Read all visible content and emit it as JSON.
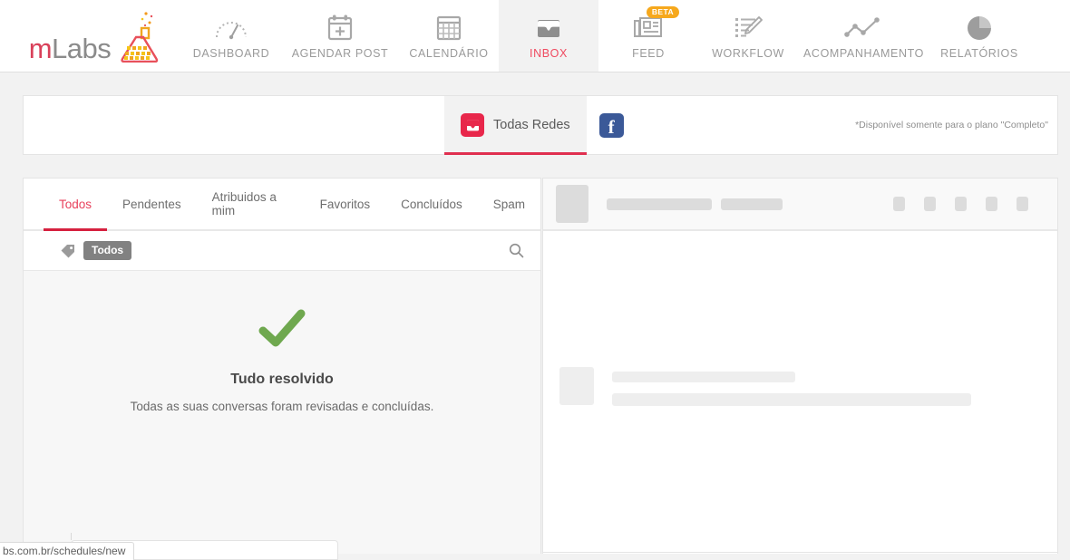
{
  "brand": {
    "name_prefix": "m",
    "name_suffix": "Labs",
    "accent_red": "#d9415a",
    "accent_gray": "#8b8b8b"
  },
  "topnav": {
    "items": [
      {
        "label": "DASHBOARD",
        "icon": "gauge-icon",
        "active": false,
        "badge": null
      },
      {
        "label": "AGENDAR POST",
        "icon": "calendar-plus-icon",
        "active": false,
        "badge": null
      },
      {
        "label": "CALENDÁRIO",
        "icon": "calendar-icon",
        "active": false,
        "badge": null
      },
      {
        "label": "INBOX",
        "icon": "inbox-icon",
        "active": true,
        "badge": null
      },
      {
        "label": "FEED",
        "icon": "newspaper-icon",
        "active": false,
        "badge": "BETA"
      },
      {
        "label": "WORKFLOW",
        "icon": "list-pencil-icon",
        "active": false,
        "badge": null
      },
      {
        "label": "ACOMPANHAMENTO",
        "icon": "line-chart-icon",
        "active": false,
        "badge": null
      },
      {
        "label": "RELATÓRIOS",
        "icon": "pie-chart-icon",
        "active": false,
        "badge": null
      }
    ],
    "active_color": "#ef4a60",
    "inactive_color": "#9a9a9a"
  },
  "network_bar": {
    "all_networks_label": "Todas Redes",
    "all_networks_icon": "inbox-icon",
    "all_networks_color": "#e8274b",
    "facebook_icon": "facebook-icon",
    "facebook_glyph": "f",
    "facebook_color": "#3b5998",
    "note": "*Disponível somente para o plano \"Completo\""
  },
  "left_panel": {
    "tabs": [
      {
        "label": "Todos",
        "active": true
      },
      {
        "label": "Pendentes",
        "active": false
      },
      {
        "label": "Atribuidos a mim",
        "active": false
      },
      {
        "label": "Favoritos",
        "active": false
      },
      {
        "label": "Concluídos",
        "active": false
      },
      {
        "label": "Spam",
        "active": false
      }
    ],
    "tag_row": {
      "tag_icon": "tag-icon",
      "chip_label": "Todos",
      "chip_color": "#818181",
      "search_icon": "search-icon"
    },
    "empty_state": {
      "icon": "check-mark-icon",
      "icon_color": "#6fa84f",
      "title": "Tudo resolvido",
      "subtitle": "Todas as suas conversas foram revisadas e concluídas."
    }
  },
  "right_panel": {
    "state": "loading-skeleton",
    "header_skeleton": {
      "avatar": true,
      "lines": 2,
      "action_buttons": 5
    },
    "body_skeleton": {
      "avatar": true,
      "lines": 2
    }
  },
  "status_bar": {
    "url_text": "bs.com.br/schedules/new"
  }
}
